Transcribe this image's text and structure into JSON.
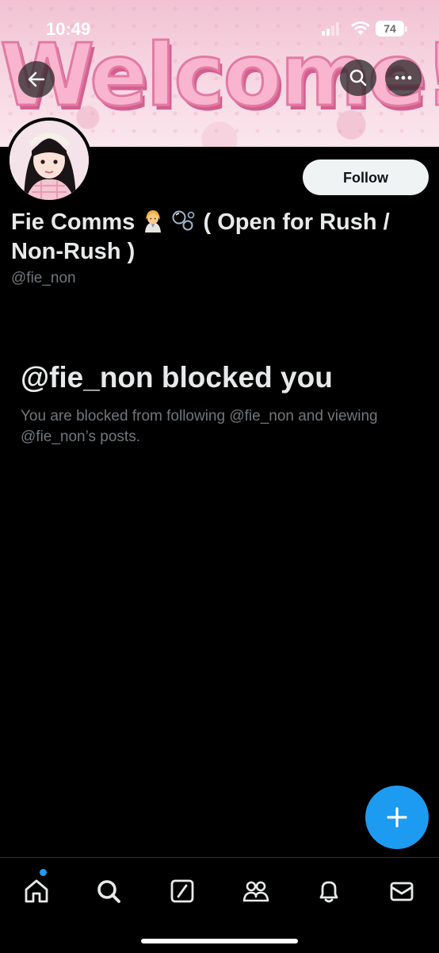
{
  "status": {
    "time": "10:49",
    "battery": "74"
  },
  "banner": {
    "text": "Welcome!"
  },
  "profile": {
    "name_prefix": "Fie Comms",
    "name_suffix": " ( Open for Rush / Non-Rush )",
    "handle": "@fie_non",
    "follow_label": "Follow"
  },
  "blocked": {
    "title": "@fie_non blocked you",
    "description": "You are blocked from following @fie_non and viewing @fie_non’s posts."
  },
  "nav": {
    "items": [
      "home-icon",
      "search-icon",
      "grok-icon",
      "communities-icon",
      "notifications-icon",
      "messages-icon"
    ]
  },
  "colors": {
    "accent": "#1d9bf0",
    "muted": "#71767b",
    "text": "#e7e9ea"
  }
}
